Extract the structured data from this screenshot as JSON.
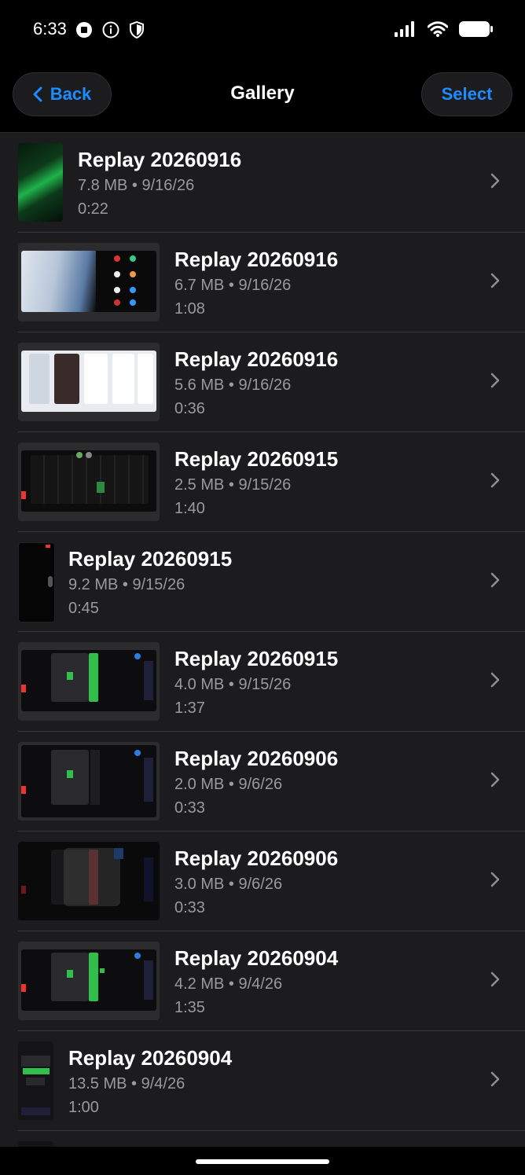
{
  "status": {
    "time": "6:33",
    "left_icons": [
      "record-icon",
      "info-icon",
      "shield-icon"
    ],
    "right_icons": [
      "signal-icon",
      "wifi-icon",
      "battery-icon"
    ]
  },
  "nav": {
    "back_label": "Back",
    "title": "Gallery",
    "select_label": "Select",
    "accent": "#1e8cff"
  },
  "items": [
    {
      "title": "Replay 20260916",
      "meta": "7.8 MB • 9/16/26",
      "duration": "0:22"
    },
    {
      "title": "Replay 20260916",
      "meta": "6.7 MB • 9/16/26",
      "duration": "1:08"
    },
    {
      "title": "Replay 20260916",
      "meta": "5.6 MB • 9/16/26",
      "duration": "0:36"
    },
    {
      "title": "Replay 20260915",
      "meta": "2.5 MB • 9/15/26",
      "duration": "1:40"
    },
    {
      "title": "Replay 20260915",
      "meta": "9.2 MB • 9/15/26",
      "duration": "0:45"
    },
    {
      "title": "Replay 20260915",
      "meta": "4.0 MB • 9/15/26",
      "duration": "1:37"
    },
    {
      "title": "Replay 20260906",
      "meta": "2.0 MB • 9/6/26",
      "duration": "0:33"
    },
    {
      "title": "Replay 20260906",
      "meta": "3.0 MB • 9/6/26",
      "duration": "0:33"
    },
    {
      "title": "Replay 20260904",
      "meta": "4.2 MB • 9/4/26",
      "duration": "1:35"
    },
    {
      "title": "Replay 20260904",
      "meta": "13.5 MB • 9/4/26",
      "duration": "1:00"
    }
  ]
}
